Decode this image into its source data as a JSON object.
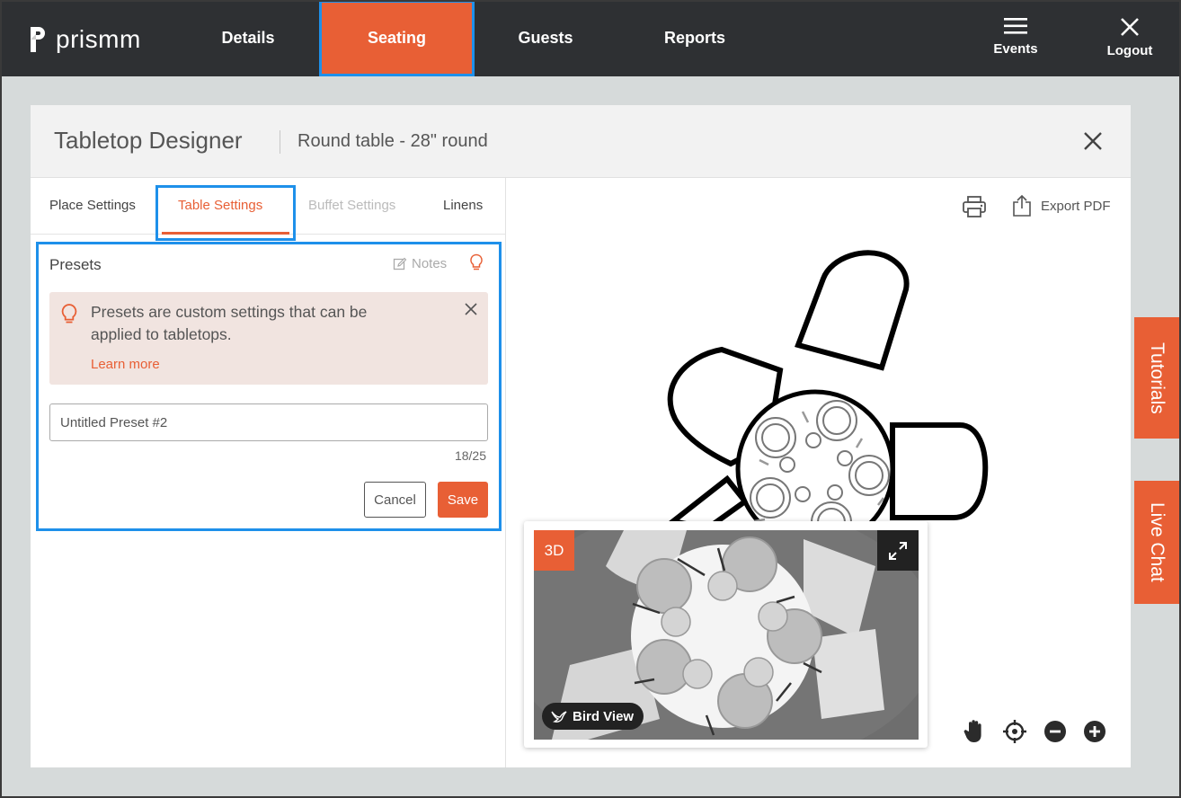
{
  "app": {
    "logo_text": "prismm"
  },
  "nav": {
    "items": [
      {
        "label": "Details"
      },
      {
        "label": "Seating"
      },
      {
        "label": "Guests"
      },
      {
        "label": "Reports"
      }
    ],
    "events_label": "Events",
    "logout_label": "Logout",
    "active": "Seating"
  },
  "modal": {
    "title": "Tabletop Designer",
    "subtitle": "Round table - 28\" round",
    "tabs": [
      {
        "label": "Place Settings",
        "state": "normal"
      },
      {
        "label": "Table Settings",
        "state": "active"
      },
      {
        "label": "Buffet Settings",
        "state": "disabled"
      },
      {
        "label": "Linens",
        "state": "normal"
      }
    ],
    "presets": {
      "title": "Presets",
      "notes_label": "Notes",
      "info_text": "Presets are custom settings that can be applied to tabletops.",
      "learn_more": "Learn more",
      "input_value": "Untitled Preset #2",
      "char_count": "18/25",
      "cancel_label": "Cancel",
      "save_label": "Save"
    },
    "toolbar": {
      "export_label": "Export PDF"
    },
    "preview": {
      "badge": "3D",
      "bird_view_label": "Bird View"
    }
  },
  "side_tabs": {
    "tutorials": "Tutorials",
    "live_chat": "Live Chat"
  },
  "colors": {
    "accent": "#e85f35",
    "nav_bg": "#2e3033",
    "highlight": "#1e90ea",
    "info_bg": "#f1e4e0"
  }
}
